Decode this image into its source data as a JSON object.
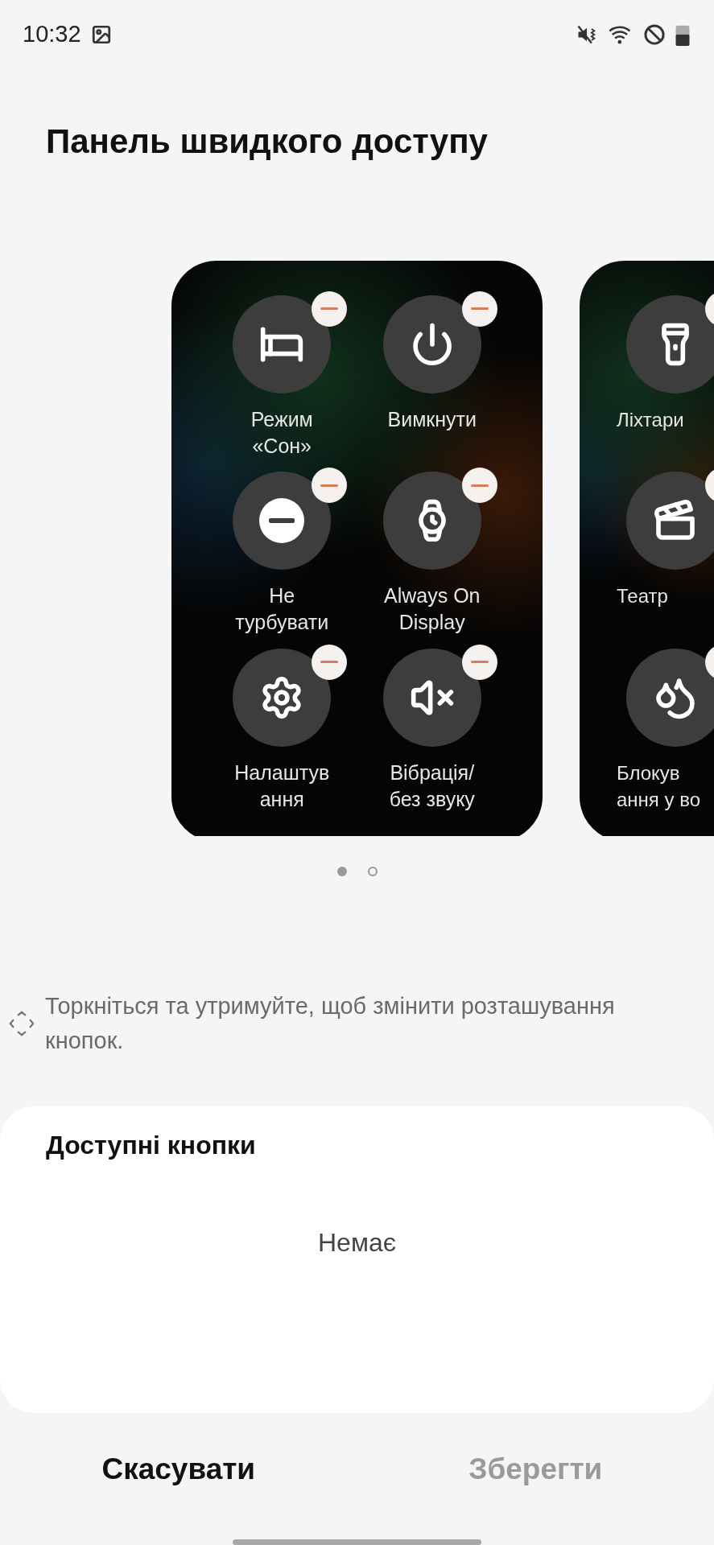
{
  "status_bar": {
    "time": "10:32"
  },
  "title": "Панель швидкого доступу",
  "pages": [
    {
      "buttons": [
        {
          "label": [
            "Режим",
            "«Сон»"
          ]
        },
        {
          "label": [
            "Вимкнути"
          ]
        },
        {
          "label": [
            "Не",
            "турбувати"
          ]
        },
        {
          "label": [
            "Always On",
            "Display"
          ]
        },
        {
          "label": [
            "Налаштув",
            "ання"
          ]
        },
        {
          "label": [
            "Вібрація/",
            "без звуку"
          ]
        }
      ]
    },
    {
      "buttons": [
        {
          "label": [
            "Ліхтари"
          ]
        },
        {
          "label": [
            "Театр"
          ]
        },
        {
          "label": [
            "Блокув",
            "ання у во"
          ]
        }
      ]
    }
  ],
  "page_indicator": [
    {
      "selected": true
    },
    {
      "selected": false
    }
  ],
  "hint": "Торкніться та утримуйте, щоб змінити розташування кнопок.",
  "available": {
    "title": "Доступні кнопки",
    "empty_text": "Немає"
  },
  "actions": [
    {
      "label": "Скасувати",
      "disabled": false
    },
    {
      "label": "Зберегти",
      "disabled": true
    }
  ]
}
